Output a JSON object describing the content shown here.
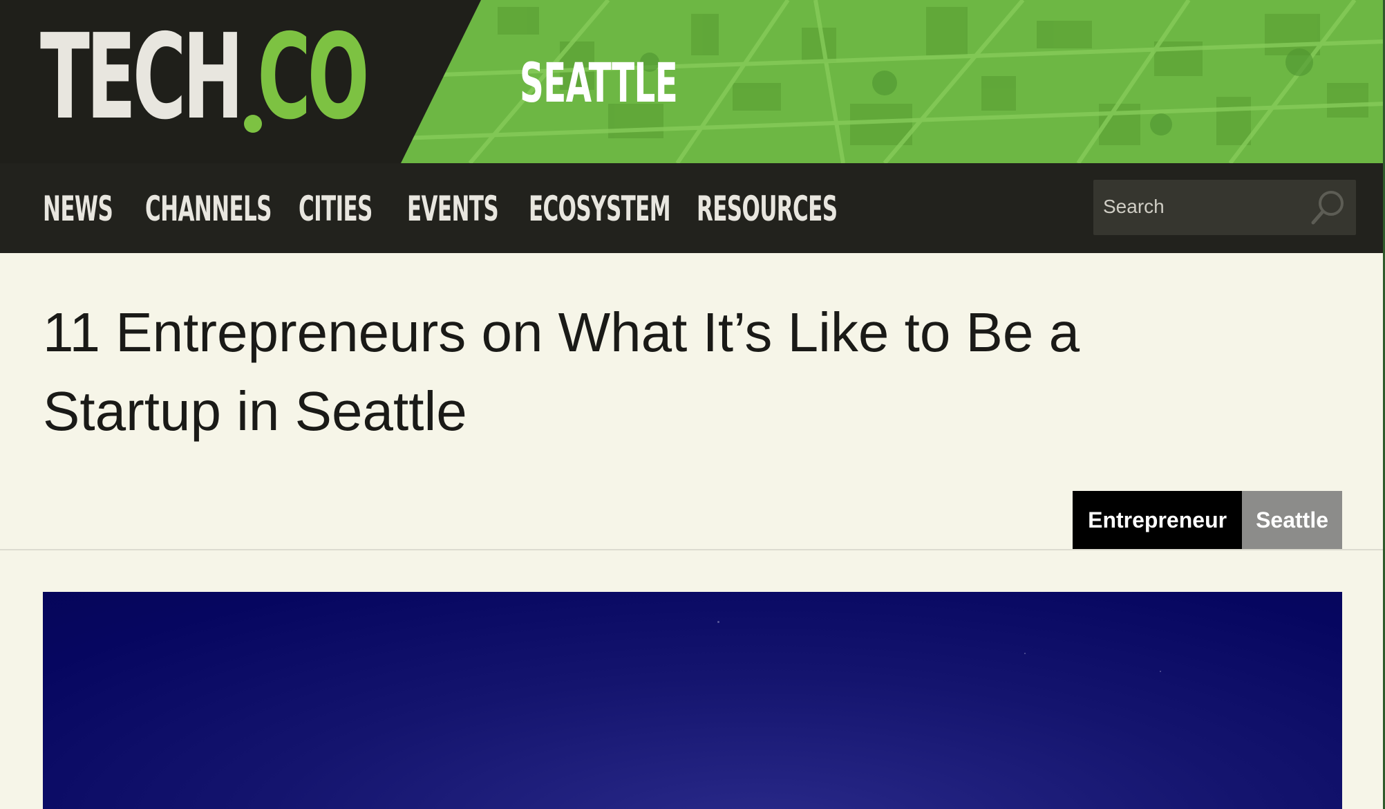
{
  "header": {
    "logo_tech": "TECH",
    "logo_co": "CO",
    "city": "SEATTLE"
  },
  "nav": {
    "items": [
      "NEWS",
      "CHANNELS",
      "CITIES",
      "EVENTS",
      "ECOSYSTEM",
      "RESOURCES"
    ],
    "search_placeholder": "Search"
  },
  "article": {
    "title": "11 Entrepreneurs on What It’s Like to Be a Startup in Seattle",
    "tags": [
      "Entrepreneur",
      "Seattle"
    ]
  },
  "colors": {
    "brand_green": "#7dc242",
    "header_dark": "#1f1f1a",
    "page_background": "#f6f5e8",
    "tag_primary": "#000000",
    "tag_secondary": "#8c8c8a",
    "hero_sky": "#060660"
  }
}
